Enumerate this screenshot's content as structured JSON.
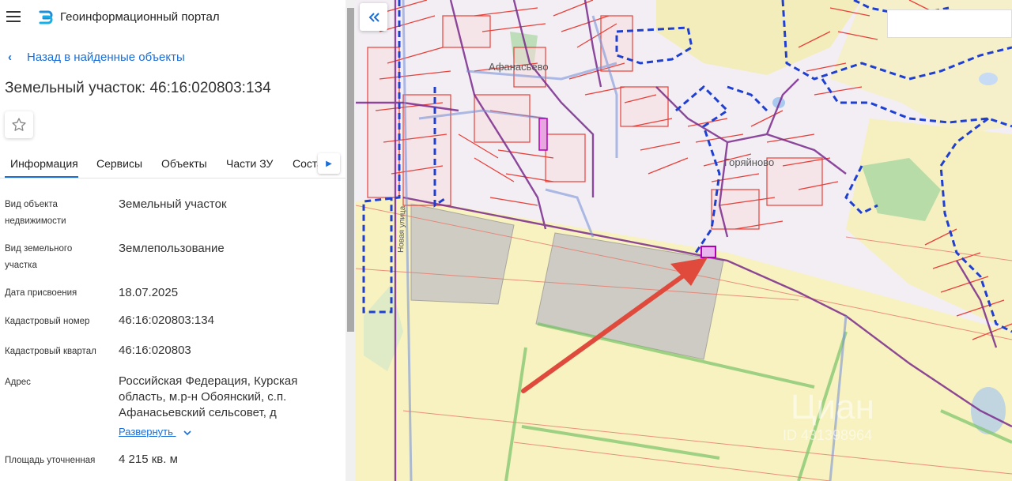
{
  "header": {
    "title": "Геоинформационный портал"
  },
  "nav": {
    "back_label": "Назад в найденные объекты"
  },
  "object": {
    "title": "Земельный участок: 46:16:020803:134"
  },
  "tabs": [
    {
      "label": "Информация"
    },
    {
      "label": "Сервисы"
    },
    {
      "label": "Объекты"
    },
    {
      "label": "Части ЗУ"
    },
    {
      "label": "Соста"
    }
  ],
  "info": {
    "rows": [
      {
        "label_lines": [
          "Вид объекта",
          "недвижимости"
        ],
        "value": "Земельный участок"
      },
      {
        "label_lines": [
          "Вид земельного",
          "участка"
        ],
        "value": "Землепользование"
      },
      {
        "label_lines": [
          "Дата присвоения"
        ],
        "value": "18.07.2025"
      },
      {
        "label_lines": [
          "Кадастровый номер"
        ],
        "value": "46:16:020803:134"
      },
      {
        "label_lines": [
          "Кадастровый квартал"
        ],
        "value": "46:16:020803"
      },
      {
        "label_lines": [
          "Адрес"
        ],
        "value_lines": [
          "Российская Федерация, Курская",
          "область, м.р-н Обоянский, с.п.",
          "Афанасьевский сельсовет, д"
        ]
      },
      {
        "label_lines": [
          "Площадь уточненная"
        ],
        "value": "4 215 кв. м"
      }
    ],
    "expand_label": "Развернуть"
  },
  "map": {
    "labels": {
      "village1": "Афанасьево",
      "village2": "Горяйново",
      "street": "Новая улица",
      "watermark": "Циан",
      "watermark_id": "ID 431398964"
    }
  },
  "colors": {
    "accent": "#1a6ed8",
    "parcel_line": "#e8403a",
    "road": "#7a2a8c",
    "boundary": "#1f3fd1",
    "field": "#f6f1b8",
    "arrow": "#e04a3c"
  }
}
